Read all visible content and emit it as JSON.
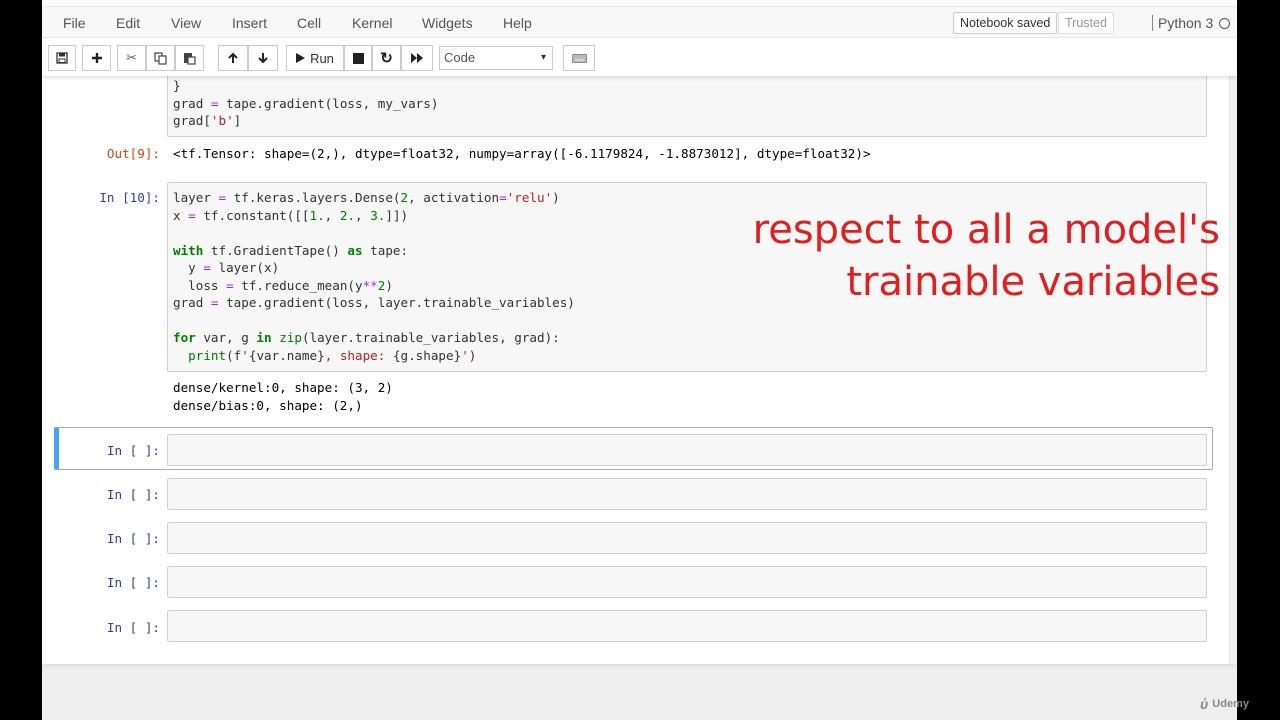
{
  "menubar": {
    "items": [
      "File",
      "Edit",
      "View",
      "Insert",
      "Cell",
      "Kernel",
      "Widgets",
      "Help"
    ],
    "status": "Notebook saved",
    "trusted": "Trusted",
    "kernel": "Python 3"
  },
  "toolbar": {
    "run_label": "Run",
    "cell_type": "Code",
    "icons": [
      "save-icon",
      "plus-icon",
      "cut-icon",
      "copy-icon",
      "paste-icon",
      "arrow-up-icon",
      "arrow-down-icon",
      "play-icon",
      "stop-icon",
      "restart-icon",
      "fast-forward-icon",
      "keyboard-icon"
    ]
  },
  "cells": {
    "prev": {
      "code": [
        "}",
        "grad = tape.gradient(loss, my_vars)",
        "grad['b']"
      ],
      "out_prompt": "Out[9]:",
      "output": "<tf.Tensor: shape=(2,), dtype=float32, numpy=array([-6.1179824, -1.8873012], dtype=float32)>"
    },
    "cell10": {
      "prompt": "In [10]:",
      "code": [
        "layer = tf.keras.layers.Dense(2, activation='relu')",
        "x = tf.constant([[1., 2., 3.]])",
        "",
        "with tf.GradientTape() as tape:",
        "  y = layer(x)",
        "  loss = tf.reduce_mean(y**2)",
        "grad = tape.gradient(loss, layer.trainable_variables)",
        "",
        "for var, g in zip(layer.trainable_variables, grad):",
        "  print(f'{var.name}, shape: {g.shape}')"
      ],
      "output": [
        "dense/kernel:0, shape: (3, 2)",
        "dense/bias:0, shape: (2,)"
      ]
    },
    "empty_prompt": "In [ ]:"
  },
  "annotation": {
    "line1": "respect to all a model's",
    "line2": "trainable variables",
    "color": "#e02020"
  },
  "watermark": "Udemy",
  "colors": {
    "selected_cell_accent": "#42a5f5",
    "in_prompt": "#303f9f",
    "out_prompt": "#d84315"
  }
}
